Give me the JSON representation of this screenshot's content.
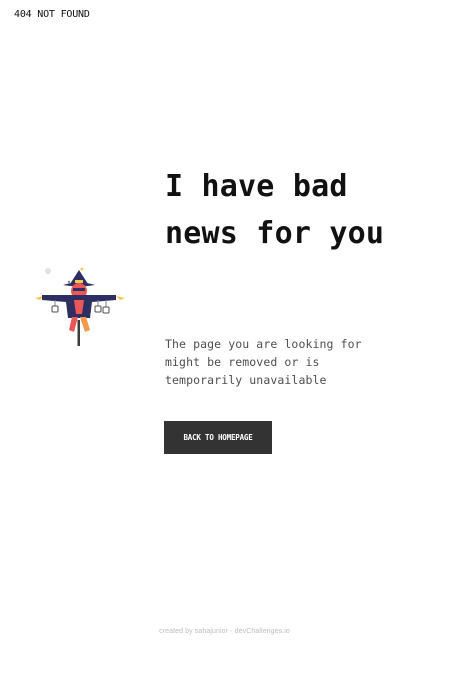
{
  "header": {
    "label": "404 NOT FOUND"
  },
  "illustration": {
    "icon": "scarecrow-icon"
  },
  "main": {
    "headline": "I have bad news for you",
    "description": "The page you are looking for might be removed or is temporarily unavailable",
    "button_label": "BACK TO HOMEPAGE"
  },
  "footer": {
    "credit": "created by sahajunior - devChallenges.io"
  },
  "colors": {
    "button_background": "#333333",
    "button_text": "#ffffff",
    "text_primary": "#111111",
    "text_secondary": "#4f4f4f",
    "footer_text": "#bdbdbd"
  }
}
